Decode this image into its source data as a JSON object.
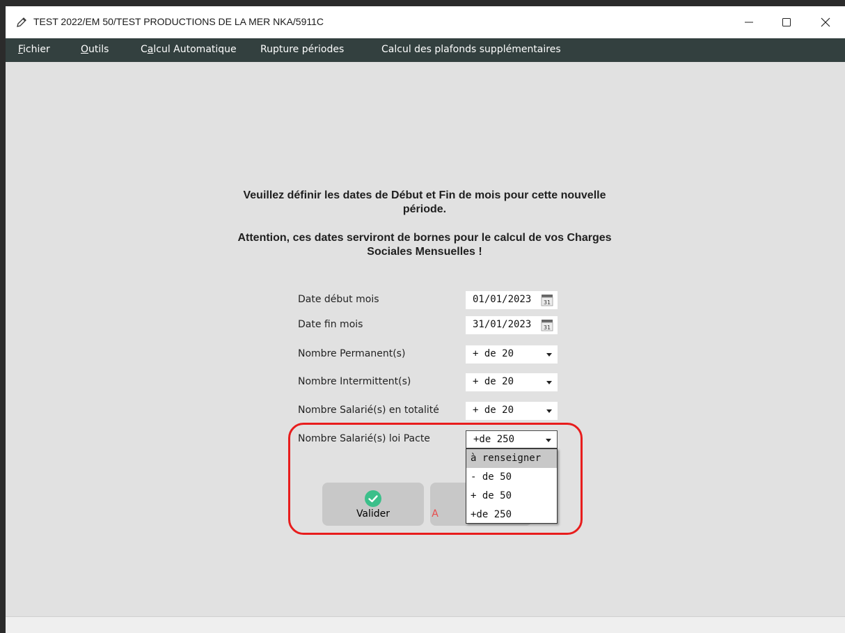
{
  "window": {
    "title": "TEST 2022/EM 50/TEST PRODUCTIONS DE LA MER NKA/5911C",
    "title_icon": "pencil-icon",
    "controls": [
      "minimize-icon",
      "maximize-icon",
      "close-icon"
    ]
  },
  "menu": {
    "items": [
      {
        "pre": "",
        "key": "F",
        "post": "ichier"
      },
      {
        "pre": "",
        "key": "O",
        "post": "utils"
      },
      {
        "pre": "C",
        "key": "a",
        "post": "lcul Automatique"
      },
      {
        "pre": "Rupture périodes",
        "key": "",
        "post": ""
      },
      {
        "pre": "Calcul des plafonds supplémentaires",
        "key": "",
        "post": ""
      }
    ]
  },
  "message": {
    "line1": "Veuillez définir les dates de Début et Fin de mois pour cette nouvelle",
    "line2": "période.",
    "line3": "Attention, ces dates serviront  de bornes pour le calcul de vos Charges",
    "line4": "Sociales Mensuelles !"
  },
  "form": {
    "date_debut": {
      "label": "Date début mois",
      "value": "01/01/2023",
      "icon": "calendar-icon",
      "icon_text": "31"
    },
    "date_fin": {
      "label": "Date fin mois",
      "value": "31/01/2023",
      "icon": "calendar-icon",
      "icon_text": "31"
    },
    "permanents": {
      "label": "Nombre Permanent(s)",
      "value": "+ de 20"
    },
    "intermittents": {
      "label": "Nombre Intermittent(s)",
      "value": "+ de 20"
    },
    "salaries_total": {
      "label": "Nombre Salarié(s) en totalité",
      "value": "+ de 20"
    },
    "salaries_pacte": {
      "label": "Nombre Salarié(s) loi Pacte",
      "value": "+de 250",
      "options": [
        "à renseigner",
        "- de 50",
        "+ de 50",
        "+de 250"
      ],
      "highlighted_option": "à renseigner"
    }
  },
  "buttons": {
    "valider": {
      "label": "Valider",
      "icon": "check-circle-icon",
      "icon_color": "#3bbf8a"
    },
    "annuler": {
      "label_visible": "A",
      "label_color": "#e84c4c"
    }
  },
  "colors": {
    "menubar": "#33403f",
    "background": "#e1e1e1",
    "highlight_border": "#e81d1d"
  }
}
